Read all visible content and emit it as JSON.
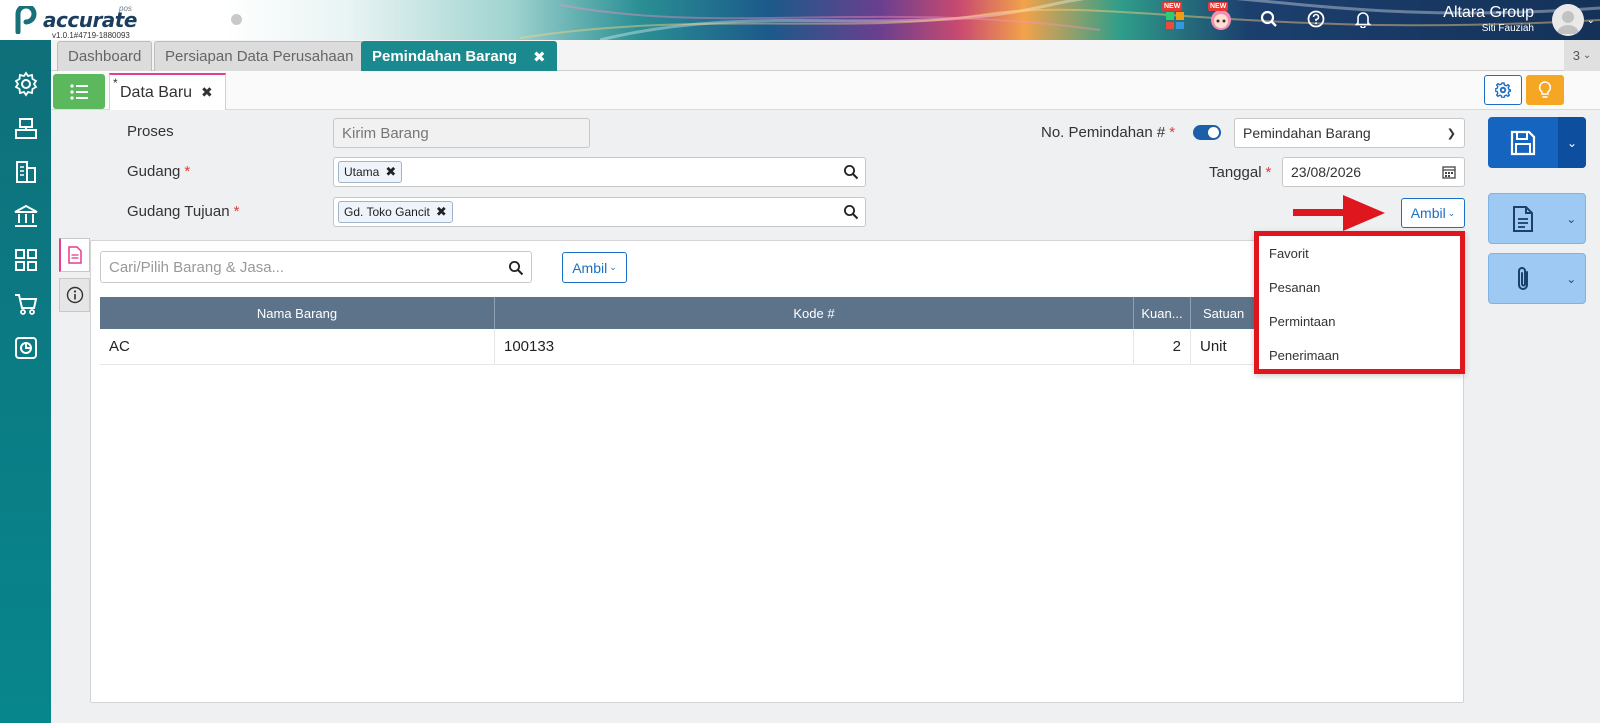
{
  "app": {
    "brand": "accurate",
    "brand_sub": "pos",
    "version": "v1.0.1#4719-1880093",
    "new_badge": "NEW",
    "company": "Altara Group",
    "user": "Siti Fauziah"
  },
  "module_tabs": [
    {
      "label": "Dashboard"
    },
    {
      "label": "Persiapan Data Perusahaan"
    },
    {
      "label": "Pemindahan Barang"
    }
  ],
  "tab_count": "3",
  "doc_tab": {
    "star": "*",
    "label": "Data Baru"
  },
  "form": {
    "proses_label": "Proses",
    "proses_value": "Kirim Barang",
    "gudang_label": "Gudang",
    "gudang_value": "Utama",
    "gudang_tujuan_label": "Gudang Tujuan",
    "gudang_tujuan_value": "Gd. Toko Gancit",
    "no_label": "No. Pemindahan #",
    "no_value": "Pemindahan Barang",
    "tanggal_label": "Tanggal",
    "tanggal_value": "23/08/2026",
    "ambil_label": "Ambil",
    "required_mark": "*"
  },
  "detail": {
    "search_placeholder": "Cari/Pilih Barang & Jasa...",
    "ambil_label": "Ambil",
    "columns": [
      "Nama Barang",
      "Kode #",
      "Kuan...",
      "Satuan"
    ],
    "rows": [
      {
        "nama": "AC",
        "kode": "100133",
        "kuantitas": "2",
        "satuan": "Unit"
      }
    ]
  },
  "ambil_menu": [
    "Favorit",
    "Pesanan",
    "Permintaan",
    "Penerimaan"
  ],
  "colors": {
    "teal": "#1a8a8f",
    "accent_blue": "#1c6fc2",
    "highlight_red": "#e0161f",
    "green": "#5cb85c"
  }
}
